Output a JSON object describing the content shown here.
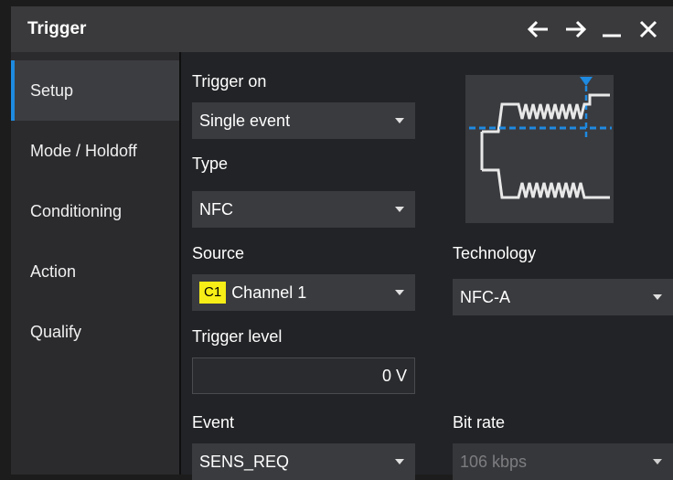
{
  "window": {
    "title": "Trigger",
    "controls": [
      "arrow-left-icon",
      "arrow-right-icon",
      "minimize-icon",
      "close-icon"
    ]
  },
  "sidebar": {
    "items": [
      {
        "label": "Setup",
        "active": true
      },
      {
        "label": "Mode / Holdoff",
        "active": false
      },
      {
        "label": "Conditioning",
        "active": false
      },
      {
        "label": "Action",
        "active": false
      },
      {
        "label": "Qualify",
        "active": false
      }
    ]
  },
  "setup": {
    "trigger_on": {
      "label": "Trigger on",
      "value": "Single event"
    },
    "type": {
      "label": "Type",
      "value": "NFC"
    },
    "source": {
      "label": "Source",
      "badge": "C1",
      "value": "Channel 1",
      "badge_color": "#f6ee16"
    },
    "technology": {
      "label": "Technology",
      "value": "NFC-A"
    },
    "trigger_level": {
      "label": "Trigger level",
      "value": "0 V"
    },
    "event": {
      "label": "Event",
      "value": "SENS_REQ"
    },
    "bit_rate": {
      "label": "Bit rate",
      "value": "106 kbps",
      "disabled": true
    }
  },
  "colors": {
    "accent": "#1e8ae0",
    "titlebar": "#3a3a3c",
    "background": "#222326",
    "sidebar": "#2b2b2e"
  }
}
